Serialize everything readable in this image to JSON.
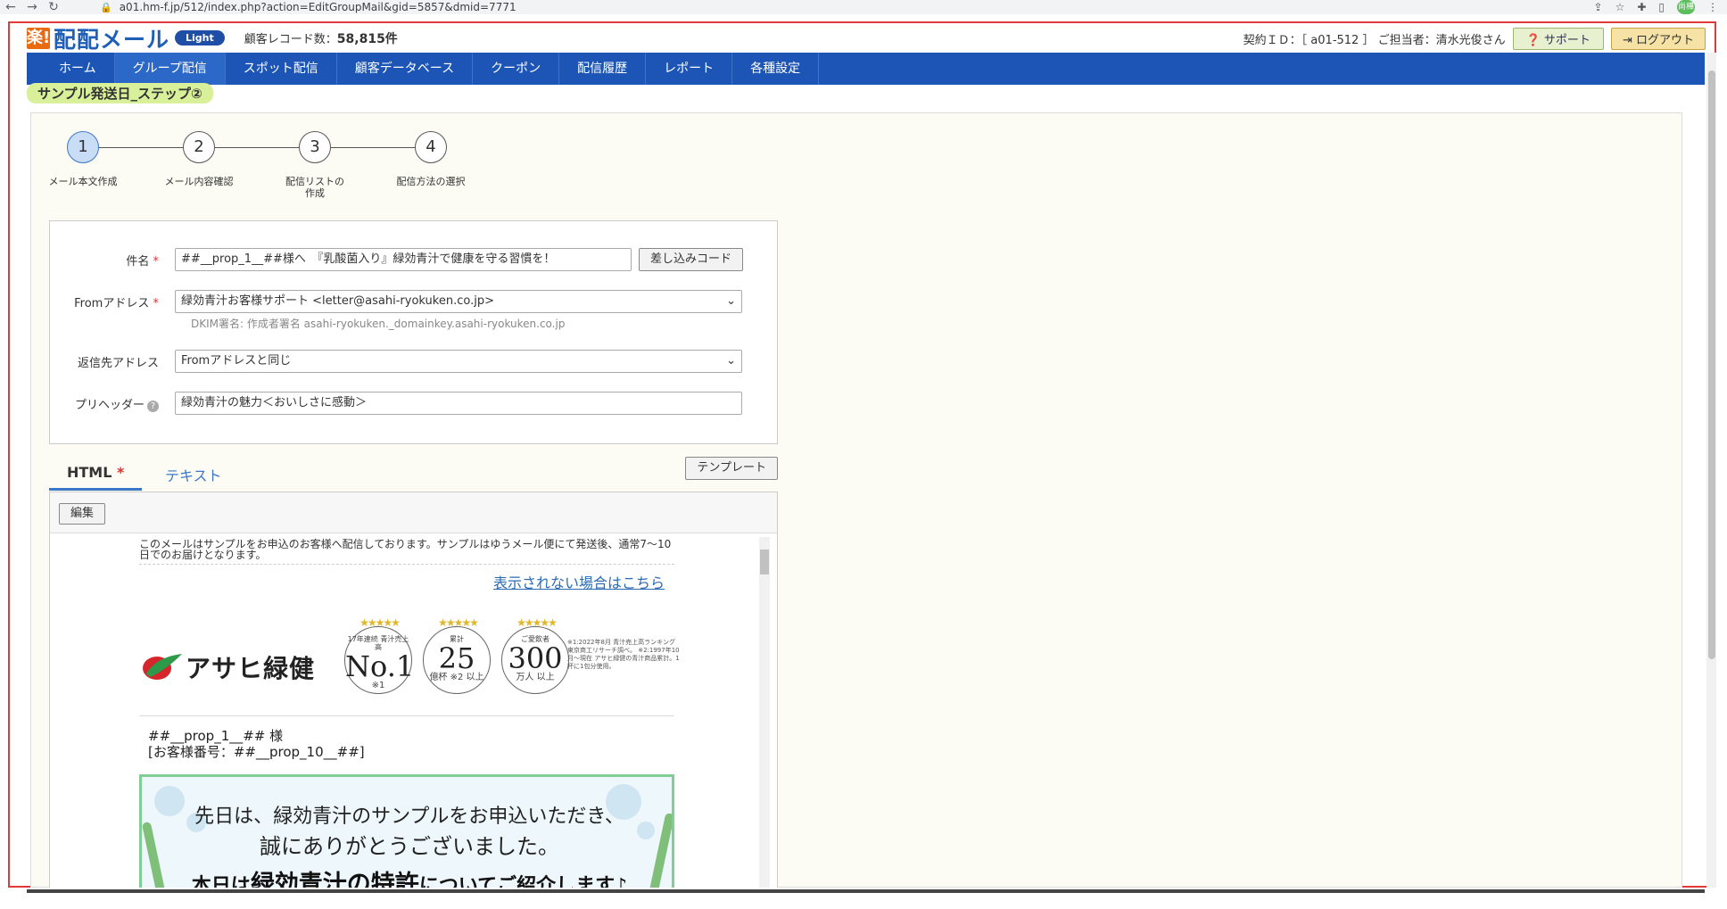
{
  "browser": {
    "url": "a01.hm-f.jp/512/index.php?action=EditGroupMail&gid=5857&dmid=7771",
    "profile": "尚樺"
  },
  "header": {
    "logo_mark": "楽!",
    "logo_text": "配配メール",
    "badge": "Light",
    "record_label": "顧客レコード数：",
    "record_count": "58,815件",
    "contract": "契約ＩＤ：［ a01-512 ］ ご担当者：清水光俊さん",
    "support_label": "サポート",
    "logout_label": "ログアウト"
  },
  "nav": [
    "ホーム",
    "グループ配信",
    "スポット配信",
    "顧客データベース",
    "クーポン",
    "配信履歴",
    "レポート",
    "各種設定"
  ],
  "page": {
    "step_tag": "サンプル発送日_ステップ②"
  },
  "steps": [
    {
      "num": "1",
      "label": "メール本文作成"
    },
    {
      "num": "2",
      "label": "メール内容確認"
    },
    {
      "num": "3",
      "label": "配信リストの作成"
    },
    {
      "num": "4",
      "label": "配信方法の選択"
    }
  ],
  "form": {
    "subject_label": "件名",
    "subject_value": "##__prop_1__##様へ　『乳酸菌入り』緑効青汁で健康を守る習慣を！",
    "insert_code_label": "差し込みコード",
    "from_label": "Fromアドレス",
    "from_value": "緑効青汁お客様サポート <letter@asahi-ryokuken.co.jp>",
    "dkim_note": "DKIM署名: 作成者署名 asahi-ryokuken._domainkey.asahi-ryokuken.co.jp",
    "reply_label": "返信先アドレス",
    "reply_value": "Fromアドレスと同じ",
    "preheader_label": "プリヘッダー",
    "preheader_value": "緑効青汁の魅力＜おいしさに感動＞"
  },
  "tabs": {
    "html_label": "HTML",
    "text_label": "テキスト",
    "template_label": "テンプレート"
  },
  "editor": {
    "edit_label": "編集",
    "notice": "このメールはサンプルをお申込のお客様へ配信しております。サンプルはゆうメール便にて発送後、通常7～10日でのお届けとなります。",
    "view_link": "表示されない場合はこちら",
    "brand": "アサヒ緑健",
    "badges": [
      {
        "top": "17年連続 青汁売上高",
        "big": "No.1",
        "unit": "※1"
      },
      {
        "top": "累計",
        "big": "25",
        "unit": "億杯 ※2 以上"
      },
      {
        "top": "ご愛飲者",
        "big": "300",
        "unit": "万人 以上"
      }
    ],
    "badge_notes": "※1:2022年8月 青汁売上高ランキング 東京商工リサーチ調べ。 ※2:1997年10月～現在 アサヒ緑健の青汁商品累計。1杯に1包分使用。",
    "greeting_1": "##__prop_1__## 様",
    "greeting_2": "[お客様番号：##__prop_10__##]",
    "hero_1": "先日は、緑効青汁のサンプルをお申込いただき、",
    "hero_2": "誠にありがとうございました。",
    "hero_3a": "本日は",
    "hero_3b": "緑効青汁の特許",
    "hero_3c": "についてご紹介します♪"
  },
  "colors": {
    "nav_bg": "#1c55b5",
    "accent": "#3b77c8",
    "frame": "#e23a3a",
    "step_tag": "#d8f09a"
  }
}
